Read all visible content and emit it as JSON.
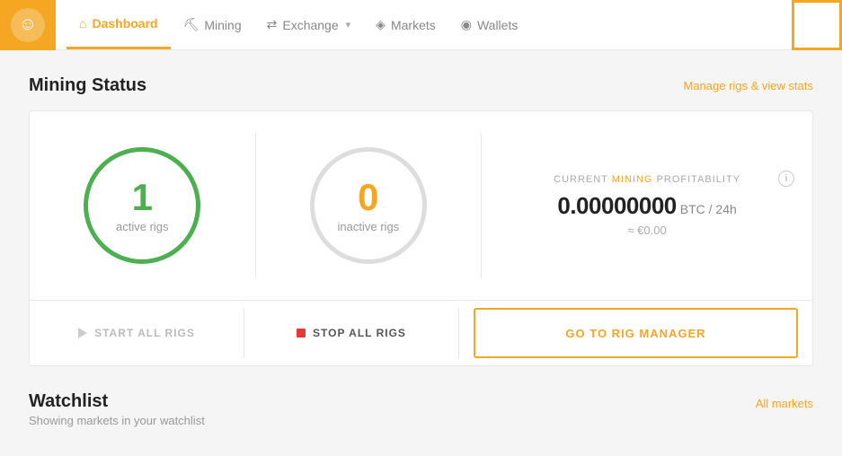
{
  "header": {
    "logo_symbol": "☺",
    "nav_items": [
      {
        "id": "dashboard",
        "label": "Dashboard",
        "icon": "⌂",
        "active": true
      },
      {
        "id": "mining",
        "label": "Mining",
        "icon": "✦",
        "active": false
      },
      {
        "id": "exchange",
        "label": "Exchange",
        "icon": "⇄",
        "active": false,
        "has_dropdown": true
      },
      {
        "id": "markets",
        "label": "Markets",
        "icon": "◈",
        "active": false
      },
      {
        "id": "wallets",
        "label": "Wallets",
        "icon": "◉",
        "active": false
      }
    ]
  },
  "mining_status": {
    "section_title": "Mining Status",
    "manage_link": "Manage rigs & view stats",
    "active_rigs_count": "1",
    "active_rigs_label": "active rigs",
    "inactive_rigs_count": "0",
    "inactive_rigs_label": "inactive rigs",
    "profitability_label_start": "CURRENT ",
    "profitability_label_highlight": "MINING",
    "profitability_label_end": " PROFITABILITY",
    "btc_value": "0.00000000",
    "btc_unit": "BTC / 24h",
    "eur_value": "≈ €0.00",
    "info_icon": "i"
  },
  "actions": {
    "start_all": "START ALL RIGS",
    "stop_all": "STOP ALL RIGS",
    "rig_manager": "GO TO RIG MANAGER"
  },
  "watchlist": {
    "title": "Watchlist",
    "subtitle": "Showing markets in your watchlist",
    "all_markets_link": "All markets"
  }
}
